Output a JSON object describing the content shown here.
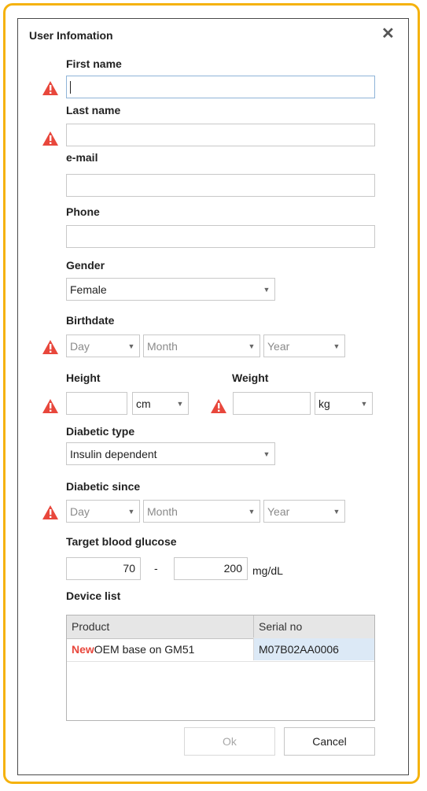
{
  "dialog": {
    "title": "User Infomation",
    "close_glyph": "✕"
  },
  "fields": {
    "first_name": {
      "label": "First name",
      "value": "",
      "required_warning": true
    },
    "last_name": {
      "label": "Last name",
      "value": "",
      "required_warning": true
    },
    "email": {
      "label": "e-mail",
      "value": ""
    },
    "phone": {
      "label": "Phone",
      "value": ""
    },
    "gender": {
      "label": "Gender",
      "value": "Female"
    },
    "birthdate": {
      "label": "Birthdate",
      "day": "Day",
      "month": "Month",
      "year": "Year",
      "required_warning": true
    },
    "height": {
      "label": "Height",
      "value": "",
      "unit": "cm",
      "required_warning": true
    },
    "weight": {
      "label": "Weight",
      "value": "",
      "unit": "kg",
      "required_warning": true
    },
    "diabetic_type": {
      "label": "Diabetic type",
      "value": "Insulin dependent"
    },
    "diabetic_since": {
      "label": "Diabetic since",
      "day": "Day",
      "month": "Month",
      "year": "Year",
      "required_warning": true
    },
    "target_glucose": {
      "label": "Target blood glucose",
      "low": "70",
      "separator": "-",
      "high": "200",
      "unit": "mg/dL"
    }
  },
  "device_list": {
    "label": "Device list",
    "columns": [
      "Product",
      "Serial no"
    ],
    "rows": [
      {
        "new_tag": "New",
        "product": "OEM base on GM51",
        "serial": "M07B02AA0006"
      }
    ]
  },
  "buttons": {
    "ok": "Ok",
    "cancel": "Cancel"
  },
  "colors": {
    "frame": "#f5b20e",
    "warning": "#e8473c",
    "selected_cell": "#dce9f6",
    "new_tag": "#e8473c"
  },
  "icons": {
    "warning": "warning-triangle-icon",
    "dropdown": "chevron-down-icon",
    "close": "close-icon"
  }
}
